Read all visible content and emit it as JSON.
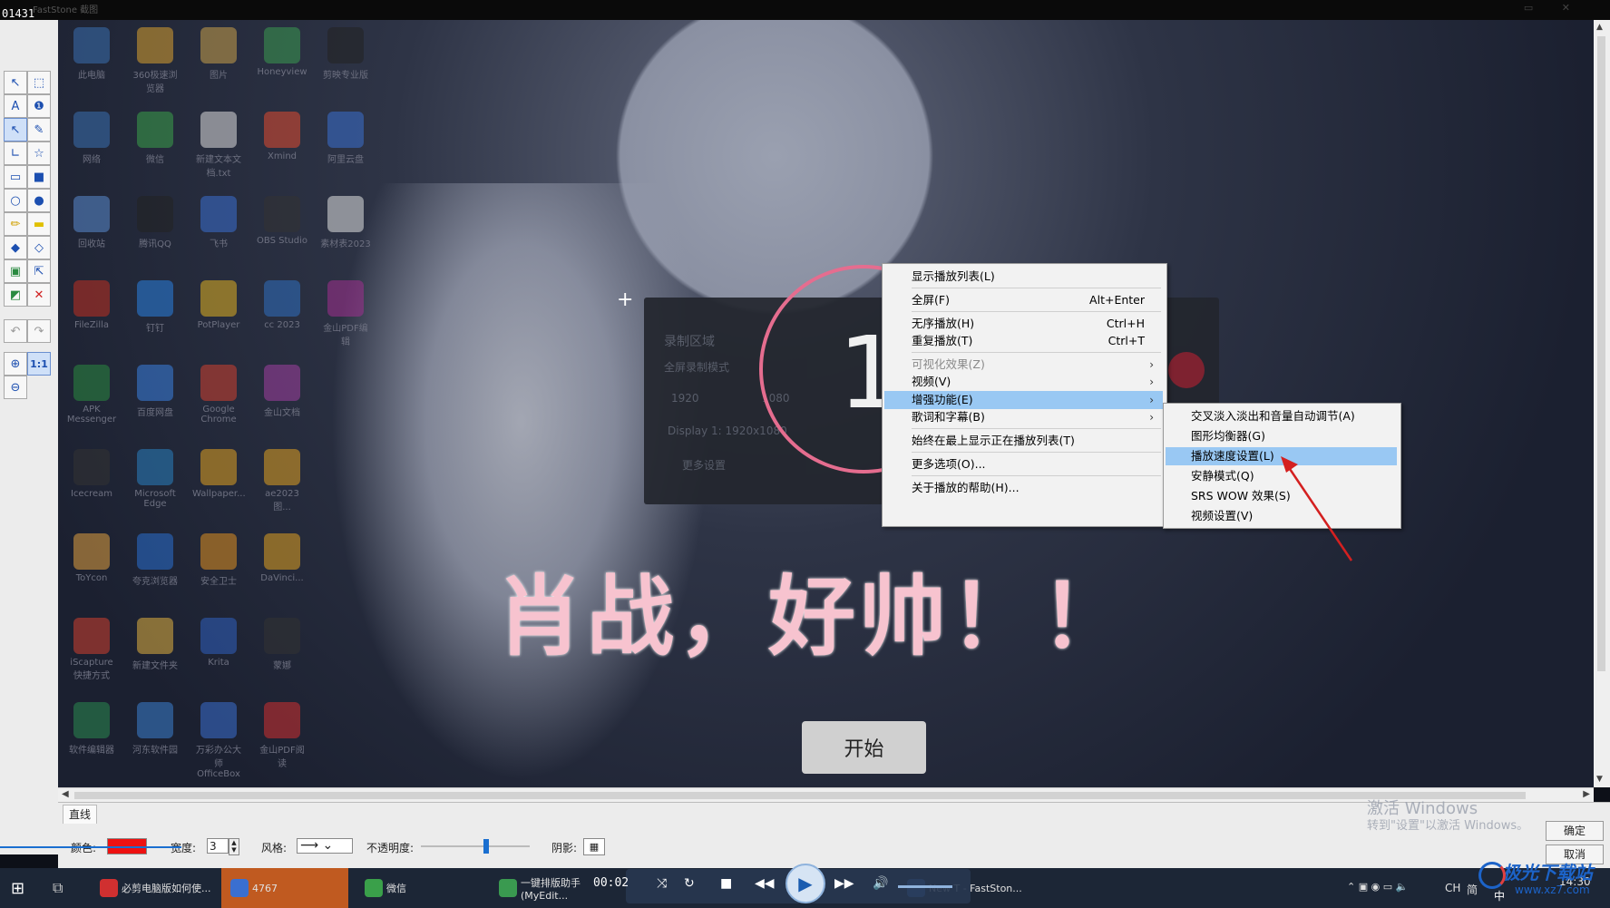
{
  "window": {
    "counter": "01431",
    "faint_title": "FastStone 截图"
  },
  "desktop_icons": [
    {
      "label": "此电脑",
      "color": "#3a6fb0"
    },
    {
      "label": "360极速浏览器",
      "color": "#d9a030"
    },
    {
      "label": "图片",
      "color": "#c9a04a"
    },
    {
      "label": "Honeyview",
      "color": "#3a9a50"
    },
    {
      "label": "剪映专业版",
      "color": "#222222"
    },
    {
      "label": "网络",
      "color": "#3a6fb0"
    },
    {
      "label": "微信",
      "color": "#3aa04a"
    },
    {
      "label": "新建文本文档.txt",
      "color": "#dddddd"
    },
    {
      "label": "Xmind",
      "color": "#e04a30"
    },
    {
      "label": "阿里云盘",
      "color": "#3a70d0"
    },
    {
      "label": "回收站",
      "color": "#5a8ad0"
    },
    {
      "label": "腾讯QQ",
      "color": "#222222"
    },
    {
      "label": "飞书",
      "color": "#3a6fd0"
    },
    {
      "label": "OBS Studio",
      "color": "#333333"
    },
    {
      "label": "素材表2023",
      "color": "#e0e0e0"
    },
    {
      "label": "FileZilla",
      "color": "#c03020"
    },
    {
      "label": "钉钉",
      "color": "#2a80e0"
    },
    {
      "label": "PotPlayer",
      "color": "#e0b020"
    },
    {
      "label": "cc 2023",
      "color": "#3070c0"
    },
    {
      "label": "金山PDF编辑",
      "color": "#a03090"
    },
    {
      "label": "APK Messenger",
      "color": "#2a8a40"
    },
    {
      "label": "百度网盘",
      "color": "#3a80e0"
    },
    {
      "label": "Google Chrome",
      "color": "#d04030"
    },
    {
      "label": "金山文档",
      "color": "#a040a0"
    },
    {
      "label": "",
      "color": "#00000000"
    },
    {
      "label": "Icecream",
      "color": "#333333"
    },
    {
      "label": "Microsoft Edge",
      "color": "#2a80c0"
    },
    {
      "label": "Wallpaper...",
      "color": "#e0a020"
    },
    {
      "label": "ae2023 图...",
      "color": "#e0a020"
    },
    {
      "label": "",
      "color": "#00000000"
    },
    {
      "label": "ToYcon",
      "color": "#e0a040"
    },
    {
      "label": "夸克浏览器",
      "color": "#2a70d0"
    },
    {
      "label": "安全卫士",
      "color": "#e09020"
    },
    {
      "label": "DaVinci...",
      "color": "#e0a020"
    },
    {
      "label": "",
      "color": "#00000000"
    },
    {
      "label": "iScapture 快捷方式",
      "color": "#d04030"
    },
    {
      "label": "新建文件夹",
      "color": "#e0b040"
    },
    {
      "label": "Krita",
      "color": "#3060c0"
    },
    {
      "label": "蒙娜",
      "color": "#333333"
    },
    {
      "label": "",
      "color": "#00000000"
    },
    {
      "label": "软件编辑器",
      "color": "#2a8a50"
    },
    {
      "label": "河东软件园",
      "color": "#3a80d0"
    },
    {
      "label": "万彩办公大师 OfficeBox",
      "color": "#3a70d0"
    },
    {
      "label": "金山PDF阅读",
      "color": "#d03030"
    },
    {
      "label": "",
      "color": "#00000000"
    }
  ],
  "recorder": {
    "title": "录制区域",
    "mode": "全屏录制模式",
    "w": "1920",
    "h": "1080",
    "display": "Display 1: 1920x1080",
    "more": "更多设置",
    "countdown": "1"
  },
  "overlay_text": {
    "headline": "肖战，好帅！！",
    "start": "开始"
  },
  "context_menu": {
    "items": [
      {
        "label": "显示播放列表(L)",
        "shortcut": "",
        "submenu": false,
        "disabled": false
      },
      {
        "label": "全屏(F)",
        "shortcut": "Alt+Enter",
        "submenu": false,
        "disabled": false
      },
      {
        "label": "无序播放(H)",
        "shortcut": "Ctrl+H",
        "submenu": false,
        "disabled": false
      },
      {
        "label": "重复播放(T)",
        "shortcut": "Ctrl+T",
        "submenu": false,
        "disabled": false
      },
      {
        "label": "可视化效果(Z)",
        "shortcut": "",
        "submenu": true,
        "disabled": true
      },
      {
        "label": "视频(V)",
        "shortcut": "",
        "submenu": true,
        "disabled": false
      },
      {
        "label": "增强功能(E)",
        "shortcut": "",
        "submenu": true,
        "disabled": false,
        "highlighted": true
      },
      {
        "label": "歌词和字幕(B)",
        "shortcut": "",
        "submenu": true,
        "disabled": false
      },
      {
        "label": "始终在最上显示正在播放列表(T)",
        "shortcut": "",
        "submenu": false,
        "disabled": false
      },
      {
        "label": "更多选项(O)...",
        "shortcut": "",
        "submenu": false,
        "disabled": false
      },
      {
        "label": "关于播放的帮助(H)...",
        "shortcut": "",
        "submenu": false,
        "disabled": false
      }
    ]
  },
  "submenu": {
    "items": [
      {
        "label": "交叉淡入淡出和音量自动调节(A)"
      },
      {
        "label": "图形均衡器(G)"
      },
      {
        "label": "播放速度设置(L)",
        "highlighted": true
      },
      {
        "label": "安静模式(Q)"
      },
      {
        "label": "SRS WOW 效果(S)"
      },
      {
        "label": "视频设置(V)"
      }
    ]
  },
  "annotation": {
    "arrow_color": "#d42020"
  },
  "properties": {
    "tab": "直线",
    "color_label": "颜色:",
    "color_value": "#ee1111",
    "width_label": "宽度:",
    "width_value": "3",
    "style_label": "风格:",
    "opacity_label": "不透明度:",
    "opacity_fraction": 0.6,
    "shadow_label": "阴影:",
    "ok": "确定",
    "cancel": "取消"
  },
  "watermark": {
    "line1": "激活 Windows",
    "line2": "转到\"设置\"以激活 Windows。"
  },
  "taskbar": {
    "items": [
      {
        "label": "必剪电脑版如何使...",
        "color": "#d03030"
      },
      {
        "label": "4767",
        "color": "#3a6fd0"
      },
      {
        "label": "微信",
        "color": "#3aa04a"
      },
      {
        "label": "一键排版助手(MyEdit...",
        "color": "#3a9a50"
      },
      {
        "label": "New T - FastSton...",
        "color": "#3a6fd0"
      }
    ],
    "player_time": "00:02",
    "tray": {
      "lang": "CH",
      "ime": "简",
      "time": "14:30",
      "ime2": "中"
    }
  },
  "brand": {
    "text": "极光下载站",
    "url": "www.xz7.com"
  }
}
